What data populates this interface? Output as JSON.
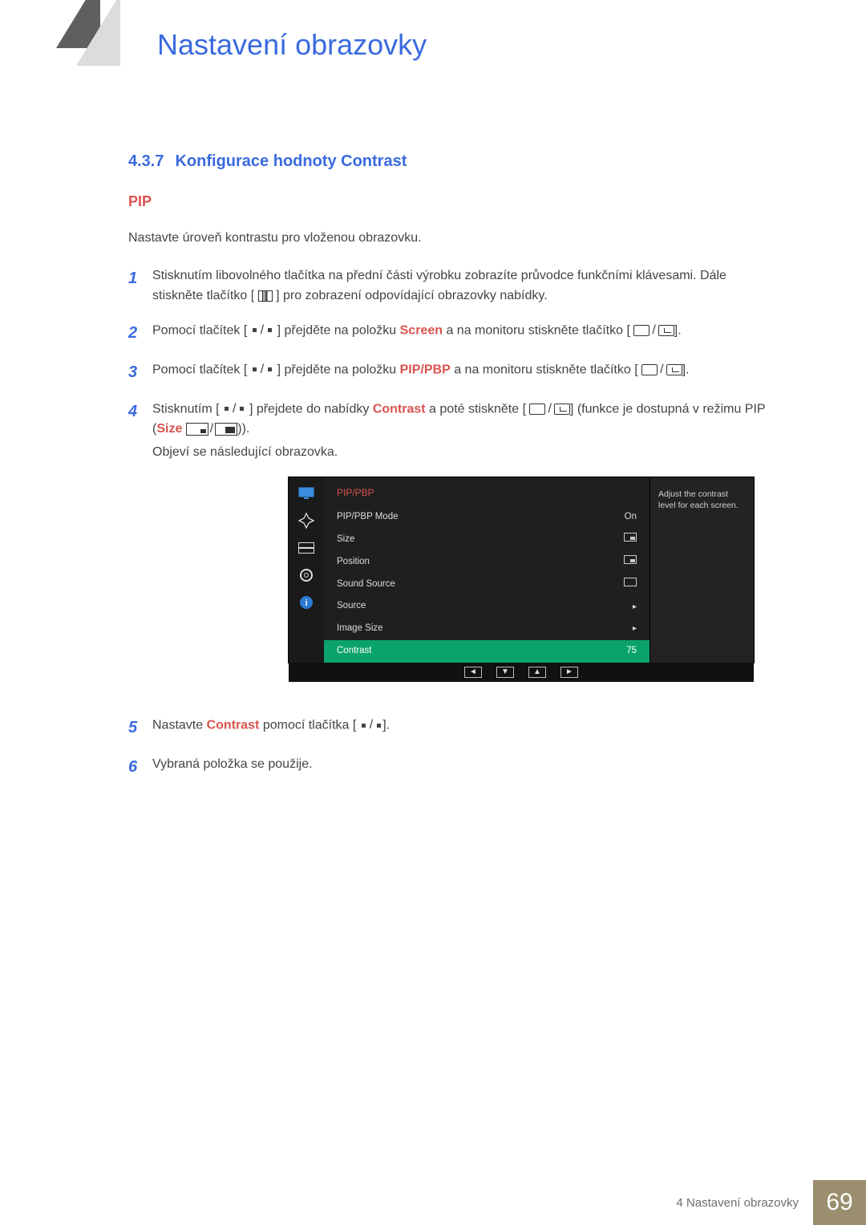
{
  "chapter_title": "Nastavení obrazovky",
  "section": {
    "number": "4.3.7",
    "title": "Konfigurace hodnoty Contrast"
  },
  "pip_label": "PIP",
  "intro": "Nastavte úroveň kontrastu pro vloženou obrazovku.",
  "steps": {
    "s1": {
      "num": "1",
      "a": "Stisknutím libovolného tlačítka na přední části výrobku zobrazíte průvodce funkčními klávesami. Dále stiskněte tlačítko [",
      "b": "] pro zobrazení odpovídající obrazovky nabídky."
    },
    "s2": {
      "num": "2",
      "a": "Pomocí tlačítek [",
      "b": "] přejděte na položku ",
      "hl": "Screen",
      "c": " a na monitoru stiskněte tlačítko [",
      "d": "]."
    },
    "s3": {
      "num": "3",
      "a": "Pomocí tlačítek [",
      "b": "] přejděte na položku ",
      "hl": "PIP/PBP",
      "c": " a na monitoru stiskněte tlačítko [",
      "d": "]."
    },
    "s4": {
      "num": "4",
      "a": "Stisknutím [",
      "b": "] přejdete do nabídky ",
      "hl": "Contrast",
      "c": " a poté stiskněte [",
      "d": "] (funkce je dostupná v režimu PIP (",
      "size": "Size",
      "e": ")).",
      "f": "Objeví se následující obrazovka."
    },
    "s5": {
      "num": "5",
      "a": "Nastavte ",
      "hl": "Contrast",
      "b": " pomocí tlačítka [",
      "c": "]."
    },
    "s6": {
      "num": "6",
      "a": "Vybraná položka se použije."
    }
  },
  "osd": {
    "title": "PIP/PBP",
    "help_a": "Adjust the contrast",
    "help_b": "level for each screen.",
    "rows": {
      "mode": {
        "label": "PIP/PBP Mode",
        "value": "On"
      },
      "size": {
        "label": "Size"
      },
      "pos": {
        "label": "Position"
      },
      "sound": {
        "label": "Sound Source"
      },
      "source": {
        "label": "Source"
      },
      "image": {
        "label": "Image Size"
      },
      "contrast": {
        "label": "Contrast",
        "value": "75"
      }
    },
    "nav": {
      "left": "◄",
      "down": "▼",
      "up": "▲",
      "right": "►"
    }
  },
  "footer": {
    "label": "4 Nastavení obrazovky",
    "page": "69"
  }
}
